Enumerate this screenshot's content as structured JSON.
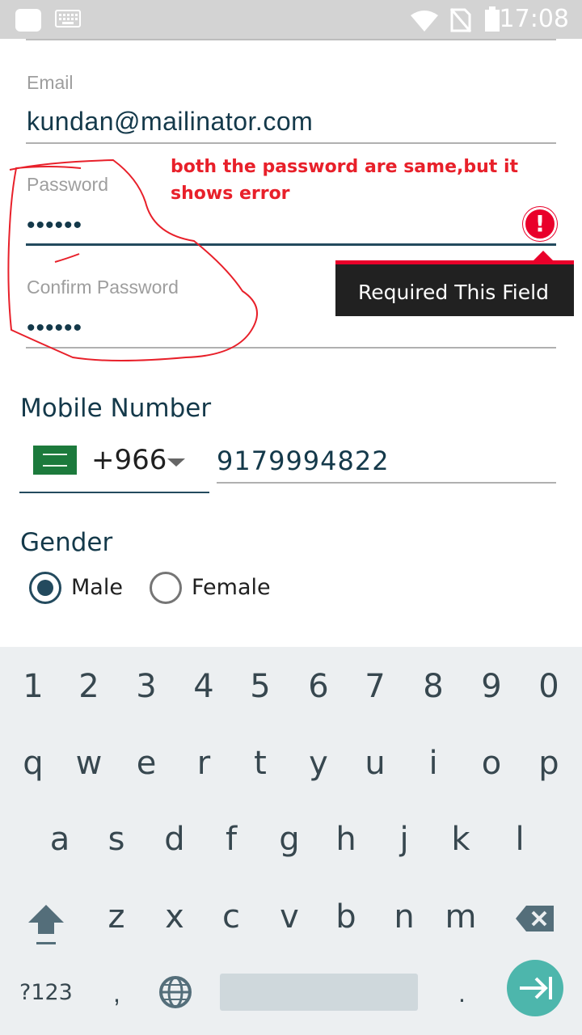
{
  "status_bar": {
    "time": "17:08",
    "icons": [
      "image-icon",
      "keyboard-icon",
      "wifi-icon",
      "no-sim-icon",
      "battery-icon"
    ]
  },
  "form": {
    "email": {
      "label": "Email",
      "value": "kundan@mailinator.com"
    },
    "password": {
      "label": "Password",
      "value": "••••••"
    },
    "confirm_password": {
      "label": "Confirm Password",
      "value": "••••••"
    },
    "error_tooltip": "Required This Field",
    "mobile": {
      "title": "Mobile Number",
      "country_code": "+966",
      "number": "9179994822"
    },
    "gender": {
      "title": "Gender",
      "options": [
        "Male",
        "Female"
      ],
      "selected": "Male"
    }
  },
  "annotation": {
    "text": "both the password are same,but it shows error",
    "color": "#e8202a"
  },
  "keyboard": {
    "row_numbers": [
      "1",
      "2",
      "3",
      "4",
      "5",
      "6",
      "7",
      "8",
      "9",
      "0"
    ],
    "row_1": [
      "q",
      "w",
      "e",
      "r",
      "t",
      "y",
      "u",
      "i",
      "o",
      "p"
    ],
    "row_2": [
      "a",
      "s",
      "d",
      "f",
      "g",
      "h",
      "j",
      "k",
      "l"
    ],
    "row_3": [
      "z",
      "x",
      "c",
      "v",
      "b",
      "n",
      "m"
    ],
    "symbols_label": "?123",
    "comma": ",",
    "period": "."
  },
  "colors": {
    "accent": "#234a5e",
    "error": "#e9002a",
    "enter_key": "#4db6ac"
  }
}
